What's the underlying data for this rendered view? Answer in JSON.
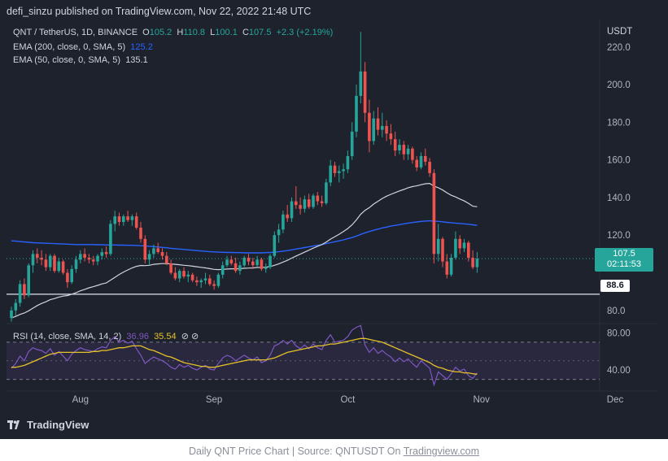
{
  "publisher": "defi_sinzu published on TradingView.com, Nov 22, 2022 21:48 UTC",
  "legend": {
    "symbol": "QNT / TetherUS, 1D, BINANCE",
    "o_label": "O",
    "o": "105.2",
    "h_label": "H",
    "h": "110.8",
    "l_label": "L",
    "l": "100.1",
    "c_label": "C",
    "c": "107.5",
    "change": "+2.3 (+2.19%)",
    "ema200_label": "EMA (200, close, 0, SMA, 5)",
    "ema200": "125.2",
    "ema50_label": "EMA (50, close, 0, SMA, 5)",
    "ema50": "135.1"
  },
  "rsi_legend": {
    "label": "RSI (14, close, SMA, 14, 2)",
    "v1": "36.96",
    "v2": "35.54",
    "icons": "⊘ ⊘"
  },
  "currency": "USDT",
  "price_tag": {
    "price": "107.5",
    "countdown": "02:11:53"
  },
  "line_tag": "88.6",
  "brand": "TradingView",
  "caption": {
    "prefix": "Daily QNT Price Chart | Source: QNTUSDT On ",
    "link": "Tradingview.com"
  },
  "colors": {
    "bg": "#1e222d",
    "up": "#26a69a",
    "down": "#ef5350",
    "ema200": "#2962ff",
    "ema50": "#d1d4dc",
    "rsi": "#7e57c2",
    "rsi_ma": "#e6c229"
  },
  "chart_data": {
    "type": "candlestick",
    "y_ticks": [
      "220.0",
      "200.0",
      "180.0",
      "160.0",
      "140.0",
      "120.0",
      "80.0"
    ],
    "ylim": [
      73,
      232
    ],
    "x_labels": [
      "Aug",
      "Sep",
      "Oct",
      "Nov",
      "Dec"
    ],
    "x_label_index": [
      16,
      47,
      78,
      109,
      140
    ],
    "horizontal_line": 88.6,
    "last_price": 107.5,
    "candles": [
      [
        76.0,
        82.0,
        74.0,
        80.0
      ],
      [
        80.0,
        86.0,
        77.0,
        84.0
      ],
      [
        84.0,
        96.0,
        82.0,
        94.0
      ],
      [
        94.0,
        97.0,
        86.0,
        88.0
      ],
      [
        88.0,
        105.0,
        87.0,
        104.0
      ],
      [
        104.0,
        112.0,
        100.0,
        110.0
      ],
      [
        110.0,
        113.0,
        105.0,
        108.0
      ],
      [
        108.0,
        112.0,
        104.0,
        107.0
      ],
      [
        107.0,
        110.0,
        101.0,
        103.0
      ],
      [
        103.0,
        110.0,
        101.0,
        109.0
      ],
      [
        109.0,
        110.0,
        100.0,
        101.0
      ],
      [
        101.0,
        108.0,
        100.0,
        106.0
      ],
      [
        106.0,
        107.0,
        99.0,
        100.0
      ],
      [
        100.0,
        102.0,
        92.0,
        95.0
      ],
      [
        95.0,
        104.0,
        94.0,
        102.0
      ],
      [
        102.0,
        109.0,
        100.0,
        107.0
      ],
      [
        107.0,
        112.0,
        105.0,
        110.0
      ],
      [
        110.0,
        113.0,
        106.0,
        108.0
      ],
      [
        108.0,
        110.0,
        105.0,
        107.0
      ],
      [
        107.0,
        109.0,
        104.0,
        106.0
      ],
      [
        106.0,
        110.0,
        104.0,
        109.0
      ],
      [
        109.0,
        113.0,
        107.0,
        111.0
      ],
      [
        111.0,
        114.0,
        108.0,
        110.0
      ],
      [
        110.0,
        128.0,
        109.0,
        126.0
      ],
      [
        126.0,
        133.0,
        122.0,
        130.0
      ],
      [
        130.0,
        132.0,
        125.0,
        127.0
      ],
      [
        127.0,
        131.0,
        125.0,
        130.0
      ],
      [
        130.0,
        133.0,
        127.0,
        128.0
      ],
      [
        128.0,
        131.0,
        125.0,
        130.0
      ],
      [
        130.0,
        132.0,
        123.0,
        124.0
      ],
      [
        124.0,
        127.0,
        116.0,
        118.0
      ],
      [
        118.0,
        120.0,
        105.0,
        107.0
      ],
      [
        107.0,
        112.0,
        104.0,
        110.0
      ],
      [
        110.0,
        115.0,
        108.0,
        113.0
      ],
      [
        113.0,
        116.0,
        110.0,
        111.0
      ],
      [
        111.0,
        113.0,
        107.0,
        109.0
      ],
      [
        109.0,
        111.0,
        104.0,
        105.0
      ],
      [
        105.0,
        107.0,
        99.0,
        100.0
      ],
      [
        100.0,
        103.0,
        96.0,
        97.0
      ],
      [
        97.0,
        102.0,
        95.0,
        101.0
      ],
      [
        101.0,
        103.0,
        97.0,
        98.0
      ],
      [
        98.0,
        101.0,
        95.0,
        99.0
      ],
      [
        99.0,
        100.0,
        95.0,
        96.0
      ],
      [
        96.0,
        98.0,
        93.0,
        95.0
      ],
      [
        95.0,
        97.0,
        92.0,
        96.0
      ],
      [
        96.0,
        100.0,
        94.0,
        97.0
      ],
      [
        97.0,
        99.0,
        93.0,
        94.0
      ],
      [
        94.0,
        96.0,
        91.0,
        93.0
      ],
      [
        93.0,
        100.0,
        92.0,
        99.0
      ],
      [
        99.0,
        106.0,
        97.0,
        104.0
      ],
      [
        104.0,
        109.0,
        103.0,
        107.0
      ],
      [
        107.0,
        109.0,
        104.0,
        105.0
      ],
      [
        105.0,
        108.0,
        100.0,
        101.0
      ],
      [
        101.0,
        106.0,
        99.0,
        104.0
      ],
      [
        104.0,
        109.0,
        103.0,
        108.0
      ],
      [
        108.0,
        110.0,
        104.0,
        106.0
      ],
      [
        106.0,
        108.0,
        102.0,
        104.0
      ],
      [
        104.0,
        109.0,
        103.0,
        107.0
      ],
      [
        107.0,
        108.0,
        101.0,
        102.0
      ],
      [
        102.0,
        105.0,
        100.0,
        103.0
      ],
      [
        103.0,
        110.0,
        102.0,
        109.0
      ],
      [
        109.0,
        122.0,
        108.0,
        120.0
      ],
      [
        120.0,
        126.0,
        116.0,
        123.0
      ],
      [
        123.0,
        133.0,
        121.0,
        131.0
      ],
      [
        131.0,
        136.0,
        127.0,
        129.0
      ],
      [
        129.0,
        140.0,
        127.0,
        138.0
      ],
      [
        138.0,
        146.0,
        134.0,
        136.0
      ],
      [
        136.0,
        140.0,
        131.0,
        134.0
      ],
      [
        134.0,
        141.0,
        132.0,
        139.0
      ],
      [
        139.0,
        142.0,
        134.0,
        135.0
      ],
      [
        135.0,
        142.0,
        134.0,
        141.0
      ],
      [
        141.0,
        143.0,
        136.0,
        138.0
      ],
      [
        138.0,
        141.0,
        135.0,
        137.0
      ],
      [
        137.0,
        150.0,
        136.0,
        148.0
      ],
      [
        148.0,
        160.0,
        146.0,
        157.0
      ],
      [
        157.0,
        159.0,
        151.0,
        153.0
      ],
      [
        153.0,
        157.0,
        148.0,
        154.0
      ],
      [
        154.0,
        158.0,
        150.0,
        155.0
      ],
      [
        155.0,
        165.0,
        153.0,
        162.0
      ],
      [
        162.0,
        180.0,
        160.0,
        175.0
      ],
      [
        175.0,
        200.0,
        172.0,
        194.0
      ],
      [
        194.0,
        228.0,
        190.0,
        207.0
      ],
      [
        207.0,
        212.0,
        180.0,
        185.0
      ],
      [
        185.0,
        192.0,
        164.0,
        170.0
      ],
      [
        170.0,
        186.0,
        168.0,
        182.0
      ],
      [
        182.0,
        188.0,
        173.0,
        176.0
      ],
      [
        176.0,
        185.0,
        172.0,
        178.0
      ],
      [
        178.0,
        181.0,
        170.0,
        174.0
      ],
      [
        174.0,
        179.0,
        168.0,
        171.0
      ],
      [
        171.0,
        175.0,
        162.0,
        165.0
      ],
      [
        165.0,
        171.0,
        163.0,
        168.0
      ],
      [
        168.0,
        170.0,
        160.0,
        163.0
      ],
      [
        163.0,
        168.0,
        160.0,
        166.0
      ],
      [
        166.0,
        167.0,
        158.0,
        160.0
      ],
      [
        160.0,
        162.0,
        154.0,
        156.0
      ],
      [
        156.0,
        164.0,
        155.0,
        162.0
      ],
      [
        162.0,
        166.0,
        157.0,
        159.0
      ],
      [
        159.0,
        161.0,
        151.0,
        153.0
      ],
      [
        153.0,
        155.0,
        105.0,
        110.0
      ],
      [
        110.0,
        126.0,
        106.0,
        118.0
      ],
      [
        118.0,
        119.0,
        103.0,
        106.0
      ],
      [
        106.0,
        110.0,
        97.0,
        99.0
      ],
      [
        99.0,
        110.0,
        98.0,
        108.0
      ],
      [
        108.0,
        122.0,
        107.0,
        118.0
      ],
      [
        118.0,
        120.0,
        110.0,
        113.0
      ],
      [
        113.0,
        118.0,
        111.0,
        116.0
      ],
      [
        116.0,
        117.0,
        106.0,
        108.0
      ],
      [
        108.0,
        112.0,
        102.0,
        103.0
      ],
      [
        103.0,
        111.0,
        100.0,
        107.5
      ]
    ],
    "ema50": [
      76.0,
      76.8,
      77.9,
      78.6,
      79.8,
      81.2,
      82.6,
      83.7,
      84.6,
      85.7,
      86.3,
      87.1,
      87.6,
      87.9,
      88.6,
      89.4,
      90.4,
      91.2,
      92.0,
      92.6,
      93.3,
      94.1,
      94.6,
      96.1,
      97.6,
      99.1,
      100.4,
      101.5,
      102.6,
      103.4,
      103.9,
      103.8,
      104.0,
      104.5,
      104.7,
      104.9,
      104.9,
      104.7,
      104.5,
      104.3,
      104.0,
      103.8,
      103.5,
      103.2,
      102.9,
      102.6,
      102.2,
      101.8,
      101.7,
      101.8,
      102.0,
      102.1,
      102.1,
      102.2,
      102.4,
      102.5,
      102.6,
      102.8,
      102.9,
      103.0,
      103.3,
      104.0,
      104.7,
      105.7,
      106.6,
      107.8,
      108.9,
      109.9,
      111.0,
      112.0,
      113.1,
      114.1,
      115.0,
      116.3,
      117.9,
      119.2,
      120.5,
      121.9,
      123.5,
      125.5,
      128.1,
      131.1,
      133.2,
      134.6,
      136.5,
      138.0,
      139.5,
      140.7,
      141.7,
      142.6,
      143.5,
      144.3,
      145.2,
      145.8,
      146.2,
      146.8,
      147.3,
      147.5,
      146.0,
      145.2,
      144.0,
      142.5,
      141.2,
      140.3,
      139.2,
      138.2,
      136.9,
      135.4,
      135.1
    ],
    "ema200": [
      117,
      116.8,
      116.6,
      116.4,
      116.2,
      116.0,
      115.9,
      115.8,
      115.7,
      115.6,
      115.5,
      115.4,
      115.3,
      115.2,
      115.1,
      115.0,
      115.0,
      115.0,
      115.0,
      115.0,
      114.9,
      114.9,
      114.8,
      114.8,
      114.8,
      114.7,
      114.7,
      114.6,
      114.6,
      114.5,
      114.4,
      114.3,
      114.1,
      113.9,
      113.7,
      113.5,
      113.3,
      113.0,
      112.8,
      112.6,
      112.4,
      112.2,
      112.0,
      111.8,
      111.6,
      111.4,
      111.2,
      111.1,
      111.0,
      110.9,
      110.8,
      110.8,
      110.7,
      110.7,
      110.6,
      110.6,
      110.6,
      110.6,
      110.6,
      110.7,
      110.8,
      111.0,
      111.2,
      111.5,
      111.8,
      112.2,
      112.6,
      113.0,
      113.4,
      113.8,
      114.2,
      114.6,
      115.0,
      115.5,
      116.0,
      116.5,
      117.0,
      117.5,
      118.1,
      118.7,
      119.5,
      120.4,
      121.2,
      121.9,
      122.6,
      123.2,
      123.8,
      124.3,
      124.8,
      125.2,
      125.6,
      126.0,
      126.4,
      126.7,
      127.0,
      127.3,
      127.5,
      127.6,
      127.4,
      127.3,
      127.1,
      126.8,
      126.6,
      126.4,
      126.2,
      126.0,
      125.8,
      125.5,
      125.2
    ],
    "rsi": {
      "ticks": [
        "80.00",
        "40.00"
      ],
      "ylim": [
        20,
        90
      ],
      "band": [
        30,
        70
      ],
      "mid": 50,
      "rsi": [
        42,
        47,
        55,
        50,
        60,
        64,
        62,
        61,
        58,
        63,
        56,
        60,
        55,
        50,
        57,
        61,
        64,
        62,
        61,
        60,
        63,
        65,
        64,
        72,
        76,
        70,
        72,
        69,
        71,
        63,
        56,
        47,
        51,
        54,
        52,
        50,
        47,
        43,
        41,
        46,
        43,
        45,
        42,
        40,
        43,
        45,
        41,
        40,
        47,
        53,
        56,
        54,
        50,
        53,
        56,
        53,
        51,
        54,
        48,
        50,
        56,
        66,
        68,
        72,
        68,
        72,
        66,
        63,
        67,
        63,
        68,
        64,
        62,
        72,
        78,
        70,
        71,
        72,
        76,
        83,
        86,
        88,
        67,
        59,
        64,
        58,
        61,
        57,
        54,
        49,
        53,
        49,
        52,
        47,
        43,
        50,
        46,
        42,
        24,
        38,
        34,
        30,
        36,
        43,
        39,
        41,
        34,
        31,
        37
      ],
      "rsi_ma": [
        43,
        43,
        44,
        45,
        47,
        49,
        51,
        53,
        55,
        57,
        58,
        59,
        59,
        59,
        59,
        59,
        59,
        59,
        59,
        60,
        60,
        61,
        61,
        62,
        63,
        64,
        64,
        65,
        66,
        66,
        66,
        64,
        62,
        61,
        59,
        57,
        55,
        54,
        52,
        50,
        48,
        47,
        46,
        45,
        44,
        44,
        43,
        43,
        44,
        45,
        46,
        47,
        48,
        49,
        50,
        51,
        51,
        51,
        51,
        51,
        52,
        53,
        55,
        57,
        59,
        60,
        61,
        62,
        63,
        64,
        65,
        66,
        66,
        67,
        68,
        68,
        69,
        70,
        71,
        72,
        73,
        74,
        74,
        73,
        72,
        71,
        70,
        68,
        66,
        64,
        62,
        60,
        58,
        56,
        54,
        52,
        50,
        48,
        45,
        43,
        42,
        40,
        39,
        38,
        38,
        37,
        37,
        36,
        35.5
      ]
    }
  }
}
